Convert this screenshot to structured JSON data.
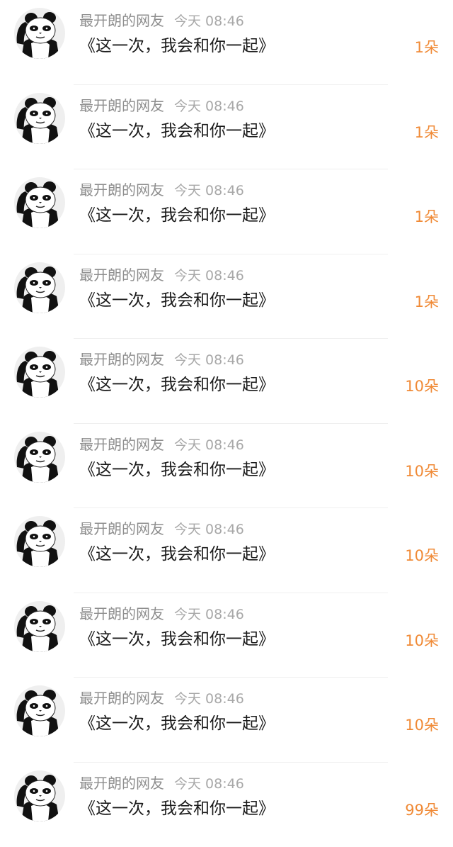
{
  "comments": [
    {
      "user": "最开朗的网友",
      "time": "今天 08:46",
      "text": "《这一次，我会和你一起》",
      "gift": "1朵"
    },
    {
      "user": "最开朗的网友",
      "time": "今天 08:46",
      "text": "《这一次，我会和你一起》",
      "gift": "1朵"
    },
    {
      "user": "最开朗的网友",
      "time": "今天 08:46",
      "text": "《这一次，我会和你一起》",
      "gift": "1朵"
    },
    {
      "user": "最开朗的网友",
      "time": "今天 08:46",
      "text": "《这一次，我会和你一起》",
      "gift": "1朵"
    },
    {
      "user": "最开朗的网友",
      "time": "今天 08:46",
      "text": "《这一次，我会和你一起》",
      "gift": "10朵"
    },
    {
      "user": "最开朗的网友",
      "time": "今天 08:46",
      "text": "《这一次，我会和你一起》",
      "gift": "10朵"
    },
    {
      "user": "最开朗的网友",
      "time": "今天 08:46",
      "text": "《这一次，我会和你一起》",
      "gift": "10朵"
    },
    {
      "user": "最开朗的网友",
      "time": "今天 08:46",
      "text": "《这一次，我会和你一起》",
      "gift": "10朵"
    },
    {
      "user": "最开朗的网友",
      "time": "今天 08:46",
      "text": "《这一次，我会和你一起》",
      "gift": "10朵"
    },
    {
      "user": "最开朗的网友",
      "time": "今天 08:46",
      "text": "《这一次，我会和你一起》",
      "gift": "99朵"
    }
  ],
  "icons": {
    "avatar": "panda-meme-avatar-icon"
  },
  "colors": {
    "username": "#8e8e8e",
    "time": "#a8a8a8",
    "message": "#1a1a1a",
    "gift_count": "#f08a36",
    "avatar_bg": "#efefef",
    "divider": "#efefef"
  }
}
